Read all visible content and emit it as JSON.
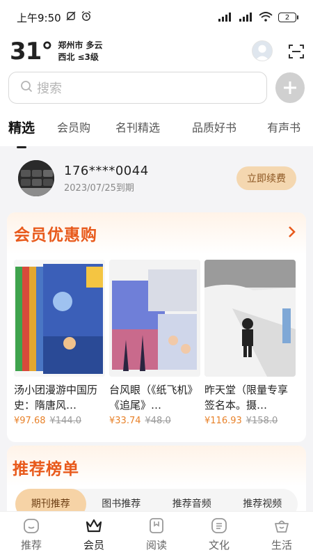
{
  "status_bar": {
    "time": "上午9:50",
    "battery": "2"
  },
  "weather": {
    "temperature": "31°",
    "city_weather": "郑州市 多云",
    "wind": "西北 ≤3级"
  },
  "search": {
    "placeholder": "搜索"
  },
  "tabs": [
    {
      "label": "精选",
      "active": true
    },
    {
      "label": "会员购",
      "active": false
    },
    {
      "label": "名刊精选",
      "active": false
    },
    {
      "label": "品质好书",
      "active": false
    },
    {
      "label": "有声书",
      "active": false
    }
  ],
  "member": {
    "phone": "176****0044",
    "expire": "2023/07/25到期",
    "renew_label": "立即续费"
  },
  "promo": {
    "title": "会员优惠购",
    "books": [
      {
        "title": "汤小团漫游中国历史：隋唐风…",
        "price": "¥97.68",
        "original_price": "¥144.0"
      },
      {
        "title": "台风眼（《纸飞机》《追尾》…",
        "price": "¥33.74",
        "original_price": "¥48.0"
      },
      {
        "title": "昨天堂（限量专享签名本。摄…",
        "price": "¥116.93",
        "original_price": "¥158.0"
      }
    ]
  },
  "rank": {
    "title": "推荐榜单",
    "tabs": [
      {
        "label": "期刊推荐",
        "active": true
      },
      {
        "label": "图书推荐",
        "active": false
      },
      {
        "label": "推荐音频",
        "active": false
      },
      {
        "label": "推荐视频",
        "active": false
      }
    ]
  },
  "bottom_nav": [
    {
      "label": "推荐",
      "icon": "face-icon",
      "active": false
    },
    {
      "label": "会员",
      "icon": "crown-icon",
      "active": true
    },
    {
      "label": "阅读",
      "icon": "book-icon",
      "active": false
    },
    {
      "label": "文化",
      "icon": "list-icon",
      "active": false
    },
    {
      "label": "生活",
      "icon": "basket-icon",
      "active": false
    }
  ],
  "colors": {
    "accent": "#e85a1c",
    "price": "#e8822a",
    "renew_bg": "#f4d7b0",
    "rank_tab_active": "#f6d3a6"
  }
}
